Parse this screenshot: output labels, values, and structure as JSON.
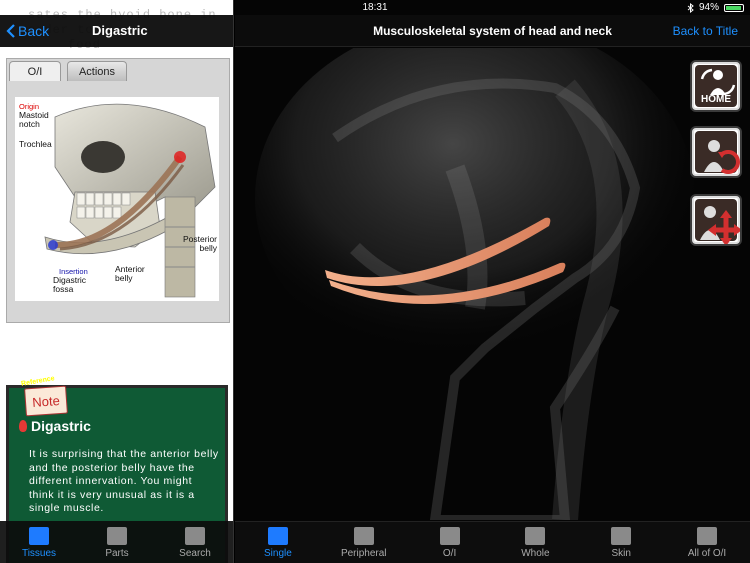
{
  "status": {
    "device": "iPad",
    "time": "18:31",
    "battery": "94%",
    "battery_level": 0.94
  },
  "left": {
    "ghost_text": [
      "sates the hyoid bone in order to",
      "food"
    ],
    "back_label": "Back",
    "title": "Digastric",
    "tabs": [
      {
        "label": "O/I"
      },
      {
        "label": "Actions"
      }
    ],
    "figure_labels": {
      "origin": "Origin",
      "mastoid": "Mastoid notch",
      "trochlea": "Trochlea",
      "posterior": "Posterior belly",
      "insertion": "Insertion",
      "digastric_fossa": "Digastric fossa",
      "anterior": "Anterior belly"
    },
    "note": {
      "badge": "Note",
      "tag": "Reference",
      "heading": "Digastric",
      "body": "It is surprising that the anterior belly and the posterior belly have the different innervation. You might think it is very unusual as it is a single muscle."
    },
    "tabbar": [
      {
        "label": "Tissues",
        "active": true
      },
      {
        "label": "Parts",
        "active": false
      },
      {
        "label": "Search",
        "active": false
      }
    ]
  },
  "right": {
    "title": "Musculoskeletal system of head and neck",
    "back_to_title": "Back to Title",
    "home_label": "HOME",
    "tabbar": [
      {
        "label": "Single",
        "active": true
      },
      {
        "label": "Peripheral",
        "active": false
      },
      {
        "label": "O/I",
        "active": false
      },
      {
        "label": "Whole",
        "active": false
      },
      {
        "label": "Skin",
        "active": false
      },
      {
        "label": "All of O/I",
        "active": false
      }
    ]
  },
  "colors": {
    "accent": "#1e90ff",
    "note_green": "#0f5a35",
    "muscle": "#e9a07a"
  }
}
